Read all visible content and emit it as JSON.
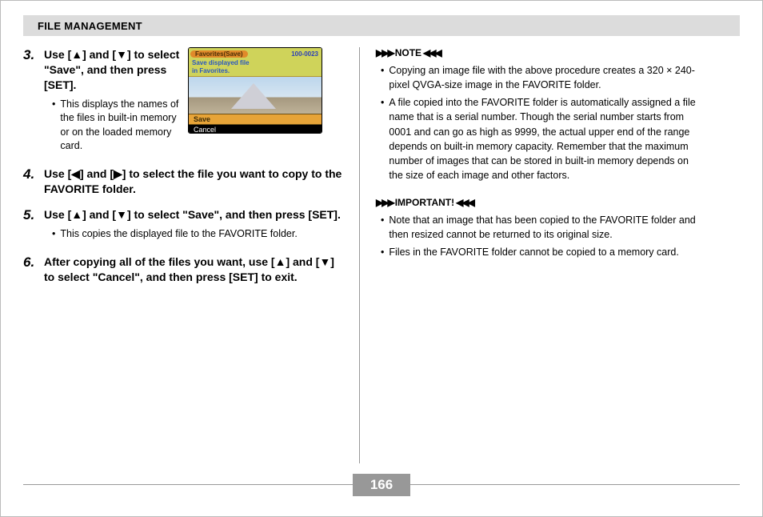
{
  "header": {
    "title": "FILE MANAGEMENT"
  },
  "steps": {
    "s3": {
      "num": "3.",
      "title": "Use [▲] and [▼] to select \"Save\", and then press [SET].",
      "bullet1": "This displays the names of the files in built-in memory or on the loaded memory card."
    },
    "s4": {
      "num": "4.",
      "title": "Use [◀] and [▶] to select the file you want to copy to the FAVORITE folder."
    },
    "s5": {
      "num": "5.",
      "title": "Use [▲] and [▼] to select \"Save\", and then press [SET].",
      "bullet1": "This copies the displayed file to the FAVORITE folder."
    },
    "s6": {
      "num": "6.",
      "title": "After copying all of the files you want, use [▲] and [▼] to select \"Cancel\", and then press [SET] to exit."
    }
  },
  "shot": {
    "topTitle": "Favorites(Save)",
    "fileNum": "100-0023",
    "sub1": "Save displayed file",
    "sub2": "in Favorites.",
    "menuSave": "Save",
    "menuCancel": "Cancel"
  },
  "note": {
    "heading": "NOTE",
    "b1": "Copying an image file with the above procedure creates a 320 × 240-pixel QVGA-size image in the FAVORITE folder.",
    "b2": "A file copied into the FAVORITE folder is automatically assigned a file name that is a serial number. Though the serial number starts from 0001 and can go as high as 9999, the actual upper end of the range depends on built-in memory capacity. Remember that the maximum number of images that can be stored in built-in memory depends on the size of each image and other factors."
  },
  "important": {
    "heading": "IMPORTANT!",
    "b1": "Note that an image that has been copied to the FAVORITE folder and then resized cannot be returned to its original size.",
    "b2": "Files in the FAVORITE folder cannot be copied to a memory card."
  },
  "pageNumber": "166"
}
